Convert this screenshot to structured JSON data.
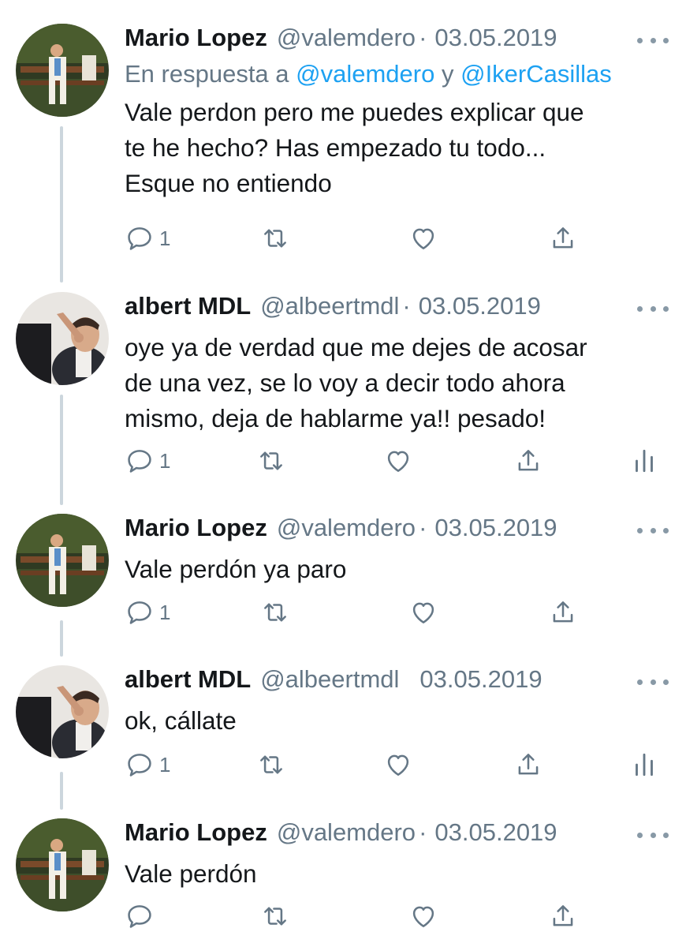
{
  "tweets": [
    {
      "author": "Mario Lopez",
      "handle": "@valemdero",
      "separator": "·",
      "date": "03.05.2019",
      "reply_prefix": "En respuesta a ",
      "reply_mention_1": "@valemdero",
      "reply_join": " y ",
      "reply_mention_2": "@IkerCasillas",
      "lines": [
        "Vale perdon pero me puedes explicar que",
        "te he hecho? Has empezado tu todo...",
        "Esque no entiendo"
      ],
      "reply_count": "1"
    },
    {
      "author": "albert MDL",
      "handle": "@albeertmdl",
      "separator": "·",
      "date": "03.05.2019",
      "lines": [
        "oye ya de verdad que me dejes de acosar",
        "de una vez, se lo voy a decir todo ahora",
        "mismo, deja de hablarme ya!! pesado!"
      ],
      "reply_count": "1"
    },
    {
      "author": "Mario Lopez",
      "handle": "@valemdero",
      "separator": "·",
      "date": "03.05.2019",
      "lines": [
        "Vale perdón ya paro"
      ],
      "reply_count": "1"
    },
    {
      "author": "albert MDL",
      "handle": "@albeertmdl",
      "separator": "",
      "date": "03.05.2019",
      "lines": [
        "ok, cállate"
      ],
      "reply_count": "1"
    },
    {
      "author": "Mario Lopez",
      "handle": "@valemdero",
      "separator": "·",
      "date": "03.05.2019",
      "lines": [
        "Vale perdón"
      ],
      "reply_count": ""
    }
  ],
  "icons": {
    "reply": "reply-icon",
    "retweet": "retweet-icon",
    "like": "heart-icon",
    "share": "share-icon",
    "analytics": "analytics-icon",
    "more": "more-icon"
  },
  "colors": {
    "text": "#14171a",
    "secondary": "#657786",
    "link": "#1da1f2",
    "thread_line": "#ccd6dd"
  }
}
